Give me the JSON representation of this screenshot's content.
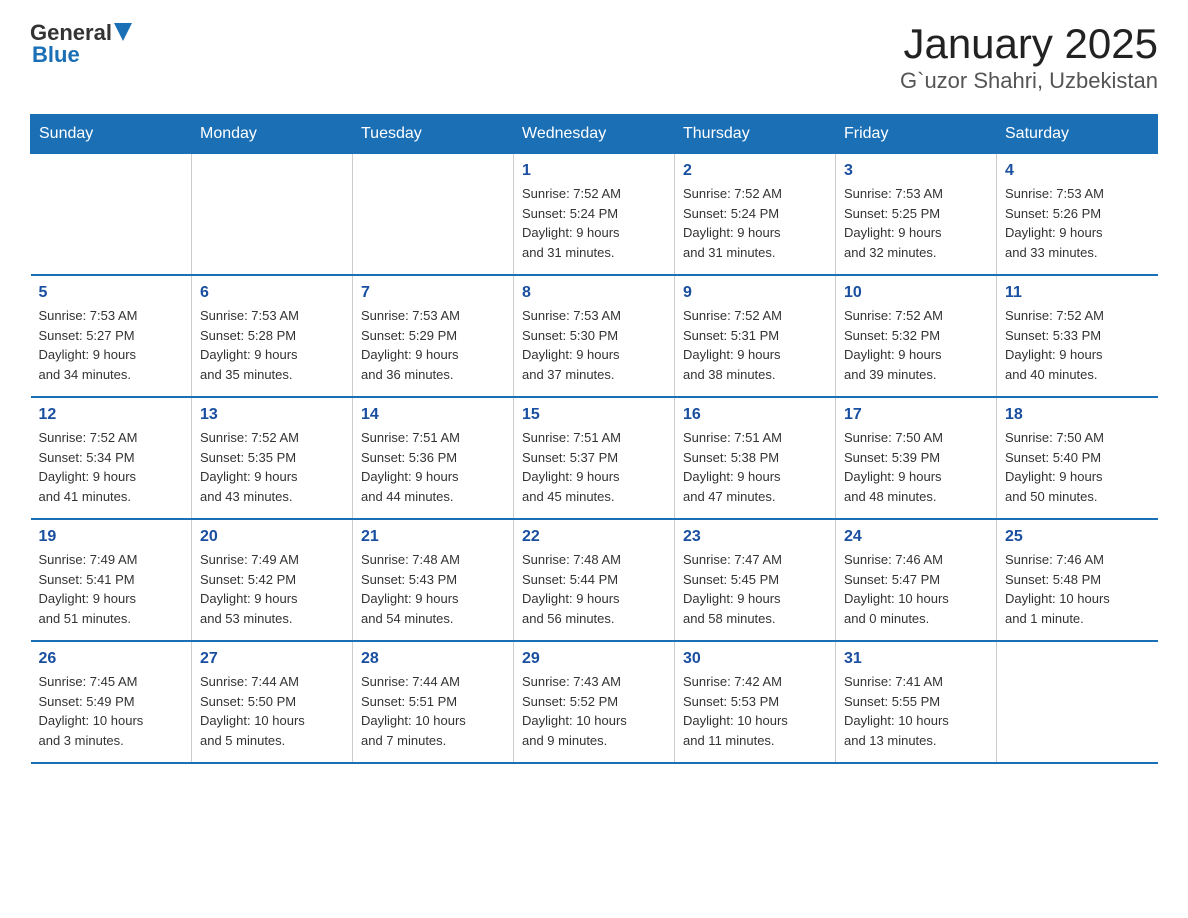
{
  "logo": {
    "general": "General",
    "blue": "Blue"
  },
  "title": "January 2025",
  "subtitle": "G`uzor Shahri, Uzbekistan",
  "days_of_week": [
    "Sunday",
    "Monday",
    "Tuesday",
    "Wednesday",
    "Thursday",
    "Friday",
    "Saturday"
  ],
  "weeks": [
    [
      {
        "day": "",
        "info": ""
      },
      {
        "day": "",
        "info": ""
      },
      {
        "day": "",
        "info": ""
      },
      {
        "day": "1",
        "info": "Sunrise: 7:52 AM\nSunset: 5:24 PM\nDaylight: 9 hours\nand 31 minutes."
      },
      {
        "day": "2",
        "info": "Sunrise: 7:52 AM\nSunset: 5:24 PM\nDaylight: 9 hours\nand 31 minutes."
      },
      {
        "day": "3",
        "info": "Sunrise: 7:53 AM\nSunset: 5:25 PM\nDaylight: 9 hours\nand 32 minutes."
      },
      {
        "day": "4",
        "info": "Sunrise: 7:53 AM\nSunset: 5:26 PM\nDaylight: 9 hours\nand 33 minutes."
      }
    ],
    [
      {
        "day": "5",
        "info": "Sunrise: 7:53 AM\nSunset: 5:27 PM\nDaylight: 9 hours\nand 34 minutes."
      },
      {
        "day": "6",
        "info": "Sunrise: 7:53 AM\nSunset: 5:28 PM\nDaylight: 9 hours\nand 35 minutes."
      },
      {
        "day": "7",
        "info": "Sunrise: 7:53 AM\nSunset: 5:29 PM\nDaylight: 9 hours\nand 36 minutes."
      },
      {
        "day": "8",
        "info": "Sunrise: 7:53 AM\nSunset: 5:30 PM\nDaylight: 9 hours\nand 37 minutes."
      },
      {
        "day": "9",
        "info": "Sunrise: 7:52 AM\nSunset: 5:31 PM\nDaylight: 9 hours\nand 38 minutes."
      },
      {
        "day": "10",
        "info": "Sunrise: 7:52 AM\nSunset: 5:32 PM\nDaylight: 9 hours\nand 39 minutes."
      },
      {
        "day": "11",
        "info": "Sunrise: 7:52 AM\nSunset: 5:33 PM\nDaylight: 9 hours\nand 40 minutes."
      }
    ],
    [
      {
        "day": "12",
        "info": "Sunrise: 7:52 AM\nSunset: 5:34 PM\nDaylight: 9 hours\nand 41 minutes."
      },
      {
        "day": "13",
        "info": "Sunrise: 7:52 AM\nSunset: 5:35 PM\nDaylight: 9 hours\nand 43 minutes."
      },
      {
        "day": "14",
        "info": "Sunrise: 7:51 AM\nSunset: 5:36 PM\nDaylight: 9 hours\nand 44 minutes."
      },
      {
        "day": "15",
        "info": "Sunrise: 7:51 AM\nSunset: 5:37 PM\nDaylight: 9 hours\nand 45 minutes."
      },
      {
        "day": "16",
        "info": "Sunrise: 7:51 AM\nSunset: 5:38 PM\nDaylight: 9 hours\nand 47 minutes."
      },
      {
        "day": "17",
        "info": "Sunrise: 7:50 AM\nSunset: 5:39 PM\nDaylight: 9 hours\nand 48 minutes."
      },
      {
        "day": "18",
        "info": "Sunrise: 7:50 AM\nSunset: 5:40 PM\nDaylight: 9 hours\nand 50 minutes."
      }
    ],
    [
      {
        "day": "19",
        "info": "Sunrise: 7:49 AM\nSunset: 5:41 PM\nDaylight: 9 hours\nand 51 minutes."
      },
      {
        "day": "20",
        "info": "Sunrise: 7:49 AM\nSunset: 5:42 PM\nDaylight: 9 hours\nand 53 minutes."
      },
      {
        "day": "21",
        "info": "Sunrise: 7:48 AM\nSunset: 5:43 PM\nDaylight: 9 hours\nand 54 minutes."
      },
      {
        "day": "22",
        "info": "Sunrise: 7:48 AM\nSunset: 5:44 PM\nDaylight: 9 hours\nand 56 minutes."
      },
      {
        "day": "23",
        "info": "Sunrise: 7:47 AM\nSunset: 5:45 PM\nDaylight: 9 hours\nand 58 minutes."
      },
      {
        "day": "24",
        "info": "Sunrise: 7:46 AM\nSunset: 5:47 PM\nDaylight: 10 hours\nand 0 minutes."
      },
      {
        "day": "25",
        "info": "Sunrise: 7:46 AM\nSunset: 5:48 PM\nDaylight: 10 hours\nand 1 minute."
      }
    ],
    [
      {
        "day": "26",
        "info": "Sunrise: 7:45 AM\nSunset: 5:49 PM\nDaylight: 10 hours\nand 3 minutes."
      },
      {
        "day": "27",
        "info": "Sunrise: 7:44 AM\nSunset: 5:50 PM\nDaylight: 10 hours\nand 5 minutes."
      },
      {
        "day": "28",
        "info": "Sunrise: 7:44 AM\nSunset: 5:51 PM\nDaylight: 10 hours\nand 7 minutes."
      },
      {
        "day": "29",
        "info": "Sunrise: 7:43 AM\nSunset: 5:52 PM\nDaylight: 10 hours\nand 9 minutes."
      },
      {
        "day": "30",
        "info": "Sunrise: 7:42 AM\nSunset: 5:53 PM\nDaylight: 10 hours\nand 11 minutes."
      },
      {
        "day": "31",
        "info": "Sunrise: 7:41 AM\nSunset: 5:55 PM\nDaylight: 10 hours\nand 13 minutes."
      },
      {
        "day": "",
        "info": ""
      }
    ]
  ]
}
